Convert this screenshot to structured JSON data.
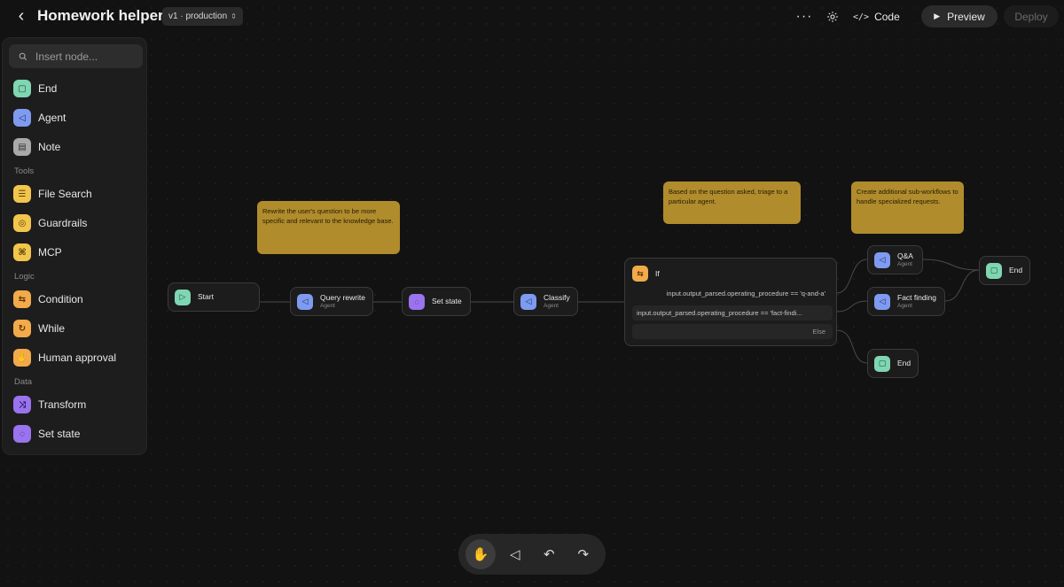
{
  "header": {
    "title": "Homework helper",
    "version": "v1 · production",
    "code_label": "Code",
    "preview_label": "Preview",
    "deploy_label": "Deploy"
  },
  "sidebar": {
    "search_placeholder": "Insert node...",
    "items_core": [
      {
        "label": "End",
        "icon": "end-icon",
        "color": "#7fd6b2"
      },
      {
        "label": "Agent",
        "icon": "agent-icon",
        "color": "#7e9bf0"
      },
      {
        "label": "Note",
        "icon": "note-icon",
        "color": "#a9a9a9"
      }
    ],
    "section_tools": "Tools",
    "items_tools": [
      {
        "label": "File Search",
        "icon": "file-search-icon",
        "color": "#f2c64d"
      },
      {
        "label": "Guardrails",
        "icon": "guardrails-icon",
        "color": "#f2c64d"
      },
      {
        "label": "MCP",
        "icon": "mcp-icon",
        "color": "#f2c64d"
      }
    ],
    "section_logic": "Logic",
    "items_logic": [
      {
        "label": "Condition",
        "icon": "condition-icon",
        "color": "#f2aa4a"
      },
      {
        "label": "While",
        "icon": "while-icon",
        "color": "#f2aa4a"
      },
      {
        "label": "Human approval",
        "icon": "human-approval-icon",
        "color": "#f2aa4a"
      }
    ],
    "section_data": "Data",
    "items_data": [
      {
        "label": "Transform",
        "icon": "transform-icon",
        "color": "#9a73ee"
      },
      {
        "label": "Set state",
        "icon": "set-state-icon",
        "color": "#9a73ee"
      }
    ]
  },
  "canvas": {
    "notes": {
      "rewrite": "Rewrite the user's question to be more specific and relevant to the knowledge base.",
      "triage": "Based on the question asked, triage to a particular agent.",
      "subworkflows": "Create additional sub-workflows to handle specialized requests."
    },
    "nodes": {
      "start": {
        "label": "Start"
      },
      "query_rewrite": {
        "label": "Query rewrite",
        "sub": "Agent"
      },
      "set_state": {
        "label": "Set state"
      },
      "classify": {
        "label": "Classify",
        "sub": "Agent"
      },
      "if": {
        "label": "If",
        "conditions": [
          "input.output_parsed.operating_procedure == 'q-and-a'",
          "input.output_parsed.operating_procedure == 'fact-findi...",
          "Else"
        ]
      },
      "qa": {
        "label": "Q&A",
        "sub": "Agent"
      },
      "fact_finding": {
        "label": "Fact finding",
        "sub": "Agent"
      },
      "end_top": {
        "label": "End"
      },
      "end_bottom": {
        "label": "End"
      }
    }
  },
  "colors": {
    "background": "#121212",
    "note": "#b08c2c",
    "end": "#7fd6b2",
    "agent": "#7e9bf0",
    "condition": "#f2aa4a",
    "state": "#9a73ee"
  }
}
